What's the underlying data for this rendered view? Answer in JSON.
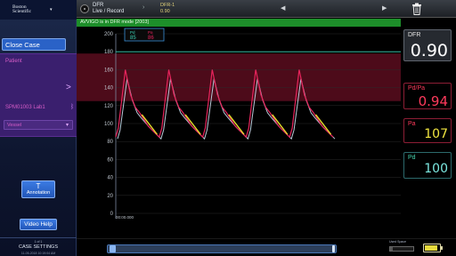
{
  "logo": {
    "text": "Boston Scientific",
    "menu_icon": "chevron-down"
  },
  "sidebar": {
    "close_case": "Close Case",
    "patient_label": "Patient",
    "case_id": "SPM01003 Lab1",
    "vessel": "Vessel",
    "annotation_letter": "T",
    "annotation": "Annotation",
    "video_help": "Video Help",
    "settings_page": "1 of 1",
    "settings": "CASE SETTINGS",
    "settings_date": "11-05-2018 10:19:04 AM"
  },
  "topbar": {
    "mode_title": "DFR",
    "mode_sub": "Live / Record",
    "run_title": "DFR-1",
    "run_value": "0.90",
    "prev": "◀",
    "next": "▶"
  },
  "banner": {
    "text": "AVVIGO is in DFR mode [2003]"
  },
  "chart": {
    "y_ticks": [
      "200",
      "180",
      "160",
      "140",
      "120",
      "100",
      "80",
      "60",
      "40",
      "20",
      "0"
    ],
    "time_label": "00:00.000",
    "legend": {
      "pd_label": "Pd",
      "pd_value": "85",
      "pa_label": "Pa",
      "pa_value": "86"
    },
    "colors": {
      "pa": "#e8245c",
      "pd": "#b9c8d8",
      "diastolic": "#e8df2a",
      "dfr_window": "#5a0d1f",
      "baseline": "#3cd6b8"
    }
  },
  "chart_data": {
    "type": "line",
    "ylim": [
      0,
      200
    ],
    "y_ticks": [
      0,
      20,
      40,
      60,
      80,
      100,
      120,
      140,
      160,
      180,
      200
    ],
    "beats": 5,
    "beat_duration_px_scaled": 1,
    "series": [
      {
        "name": "Pa",
        "peak": 160,
        "trough": 85,
        "dicrotic": 118
      },
      {
        "name": "Pd",
        "peak": 150,
        "trough": 83,
        "dicrotic": 112
      }
    ],
    "dfr_band_y": [
      125,
      178
    ],
    "reference_line_y": 180
  },
  "metrics": {
    "dfr_label": "DFR",
    "dfr_value": "0.90",
    "pdpa_label": "Pd/Pa",
    "pdpa_value": "0.94",
    "pa_label": "Pa",
    "pa_value": "107",
    "pd_label": "Pd",
    "pd_value": "100"
  },
  "bottom": {
    "storage_label": "Used Space",
    "storage_fraction": 0.1,
    "battery_fraction": 0.8
  }
}
